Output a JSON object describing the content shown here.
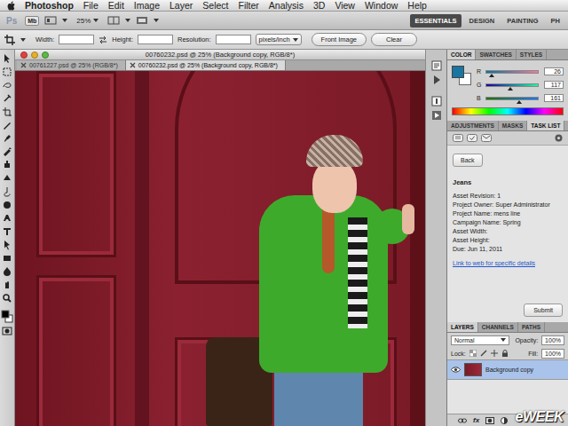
{
  "menu_bar": {
    "app": "Photoshop",
    "items": [
      "File",
      "Edit",
      "Image",
      "Layer",
      "Select",
      "Filter",
      "Analysis",
      "3D",
      "View",
      "Window",
      "Help"
    ]
  },
  "app_bar": {
    "logo": "Ps",
    "mini_bridge": "Mb",
    "zoom": "25%",
    "workspaces": [
      {
        "label": "ESSENTIALS",
        "selected": true
      },
      {
        "label": "DESIGN",
        "selected": false
      },
      {
        "label": "PAINTING",
        "selected": false
      },
      {
        "label": "PH",
        "selected": false
      }
    ]
  },
  "options_bar": {
    "width_label": "Width:",
    "height_label": "Height:",
    "resolution_label": "Resolution:",
    "unit": "pixels/inch",
    "buttons": [
      "Front Image",
      "Clear"
    ]
  },
  "document": {
    "title": "00760232.psd @ 25% (Background copy, RGB/8*)",
    "tabs": [
      {
        "label": "00761227.psd @ 25% (RGB/8*)",
        "selected": false
      },
      {
        "label": "00760232.psd @ 25% (Background copy, RGB/8*)",
        "selected": true
      }
    ]
  },
  "color_panel": {
    "tabs": [
      {
        "label": "COLOR",
        "selected": true
      },
      {
        "label": "SWATCHES",
        "selected": false
      },
      {
        "label": "STYLES",
        "selected": false
      }
    ],
    "channels": [
      {
        "name": "R",
        "value": "26",
        "level": 0.1
      },
      {
        "name": "G",
        "value": "117",
        "level": 0.46
      },
      {
        "name": "B",
        "value": "161",
        "level": 0.63
      }
    ]
  },
  "adjustments_panel": {
    "tabs": [
      {
        "label": "ADJUSTMENTS",
        "selected": false
      },
      {
        "label": "MASKS",
        "selected": false
      },
      {
        "label": "TASK LIST",
        "selected": true
      }
    ],
    "back": "Back",
    "task": {
      "title": "Jeans",
      "fields": [
        "Asset Revision: 1",
        "Project Owner: Super Administrator",
        "Project Name: mens line",
        "Campaign Name: Spring",
        "Asset Width:",
        "Asset Height:",
        "Due: Jun 11, 2011"
      ],
      "link": "Link to web for specific details",
      "submit": "Submit"
    }
  },
  "layers_panel": {
    "tabs": [
      {
        "label": "LAYERS",
        "selected": true
      },
      {
        "label": "CHANNELS",
        "selected": false
      },
      {
        "label": "PATHS",
        "selected": false
      }
    ],
    "blend_mode": "Normal",
    "opacity_label": "Opacity:",
    "opacity": "100%",
    "lock_label": "Lock:",
    "fill_label": "Fill:",
    "fill": "100%",
    "layers": [
      {
        "name": "Background copy",
        "selected": true,
        "visible": true
      }
    ],
    "footer_fx": "fx"
  },
  "watermark": "eWEEK"
}
